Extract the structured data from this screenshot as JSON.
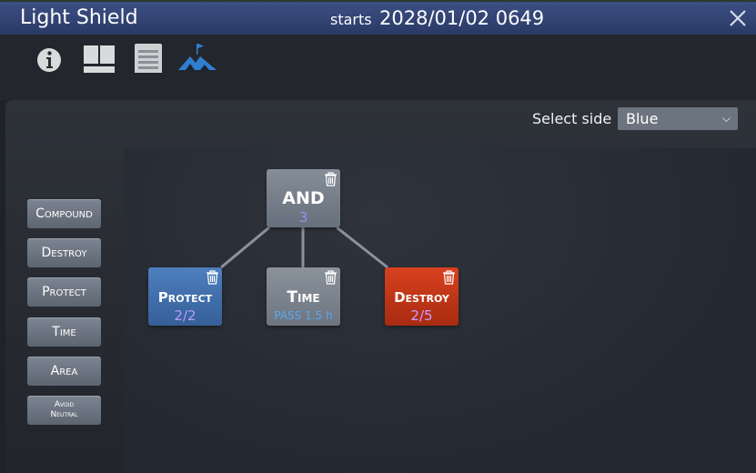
{
  "window": {
    "title": "Light Shield",
    "starts_label": "starts",
    "starts_value": "2028/01/02 0649"
  },
  "toolbar": {
    "icons": [
      "info-icon",
      "layout-icon",
      "document-icon",
      "mission-flag-icon"
    ]
  },
  "side_selector": {
    "label": "Select side",
    "value": "Blue"
  },
  "palette": {
    "compound": "Compound",
    "destroy": "Destroy",
    "protect": "Protect",
    "time": "Time",
    "area": "Area",
    "avoid_neutral_1": "Avoid",
    "avoid_neutral_2": "Neutral"
  },
  "nodes": {
    "and": {
      "title": "AND",
      "sub": "3"
    },
    "protect": {
      "title": "Protect",
      "sub": "2/2"
    },
    "time": {
      "title": "Time",
      "sub": "PASS 1.5 h"
    },
    "destroy": {
      "title": "Destroy",
      "sub": "2/5"
    }
  },
  "colors": {
    "title_bar": "#34467a",
    "protect_node": "#4474b2",
    "destroy_node": "#c6381a",
    "and_sub_text": "#9b8cf0",
    "time_sub_text": "#5aa8f0",
    "progress_text": "#b79cff"
  }
}
